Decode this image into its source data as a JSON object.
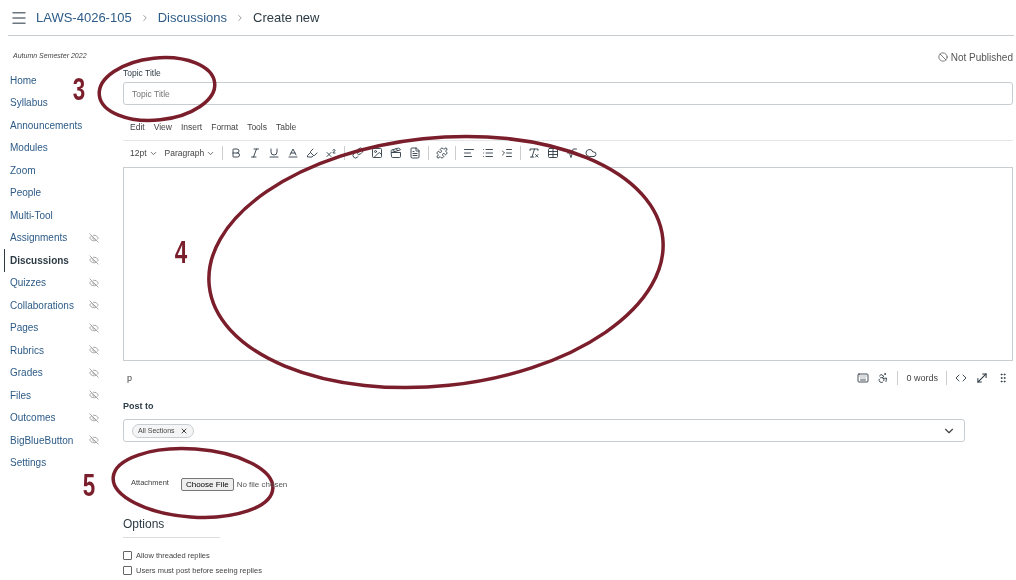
{
  "breadcrumb": [
    "LAWS-4026-105",
    "Discussions",
    "Create new"
  ],
  "sidebar": {
    "term": "Autumn Semester 2022",
    "items": [
      {
        "label": "Home",
        "selected": false,
        "hidden": false
      },
      {
        "label": "Syllabus",
        "selected": false,
        "hidden": false
      },
      {
        "label": "Announcements",
        "selected": false,
        "hidden": false
      },
      {
        "label": "Modules",
        "selected": false,
        "hidden": false
      },
      {
        "label": "Zoom",
        "selected": false,
        "hidden": false
      },
      {
        "label": "People",
        "selected": false,
        "hidden": false
      },
      {
        "label": "Multi-Tool",
        "selected": false,
        "hidden": false
      },
      {
        "label": "Assignments",
        "selected": false,
        "hidden": true
      },
      {
        "label": "Discussions",
        "selected": true,
        "hidden": true
      },
      {
        "label": "Quizzes",
        "selected": false,
        "hidden": true
      },
      {
        "label": "Collaborations",
        "selected": false,
        "hidden": true
      },
      {
        "label": "Pages",
        "selected": false,
        "hidden": true
      },
      {
        "label": "Rubrics",
        "selected": false,
        "hidden": true
      },
      {
        "label": "Grades",
        "selected": false,
        "hidden": true
      },
      {
        "label": "Files",
        "selected": false,
        "hidden": true
      },
      {
        "label": "Outcomes",
        "selected": false,
        "hidden": true
      },
      {
        "label": "BigBlueButton",
        "selected": false,
        "hidden": true
      },
      {
        "label": "Settings",
        "selected": false,
        "hidden": false
      }
    ]
  },
  "status": "Not Published",
  "topic": {
    "label": "Topic Title",
    "placeholder": "Topic Title"
  },
  "editor": {
    "menu": [
      "Edit",
      "View",
      "Insert",
      "Format",
      "Tools",
      "Table"
    ],
    "font_size": "12pt",
    "block": "Paragraph",
    "path": "p",
    "word_count": "0 words"
  },
  "post_to": {
    "label": "Post to",
    "chips": [
      "All Sections"
    ]
  },
  "attachment": {
    "label": "Attachment",
    "button": "Choose File",
    "file": "No file chosen"
  },
  "options": {
    "title": "Options",
    "items": [
      {
        "label": "Allow threaded replies",
        "checked": false
      },
      {
        "label": "Users must post before seeing replies",
        "checked": false
      }
    ]
  },
  "annotations": [
    {
      "label": "3"
    },
    {
      "label": "4"
    },
    {
      "label": "5"
    }
  ]
}
